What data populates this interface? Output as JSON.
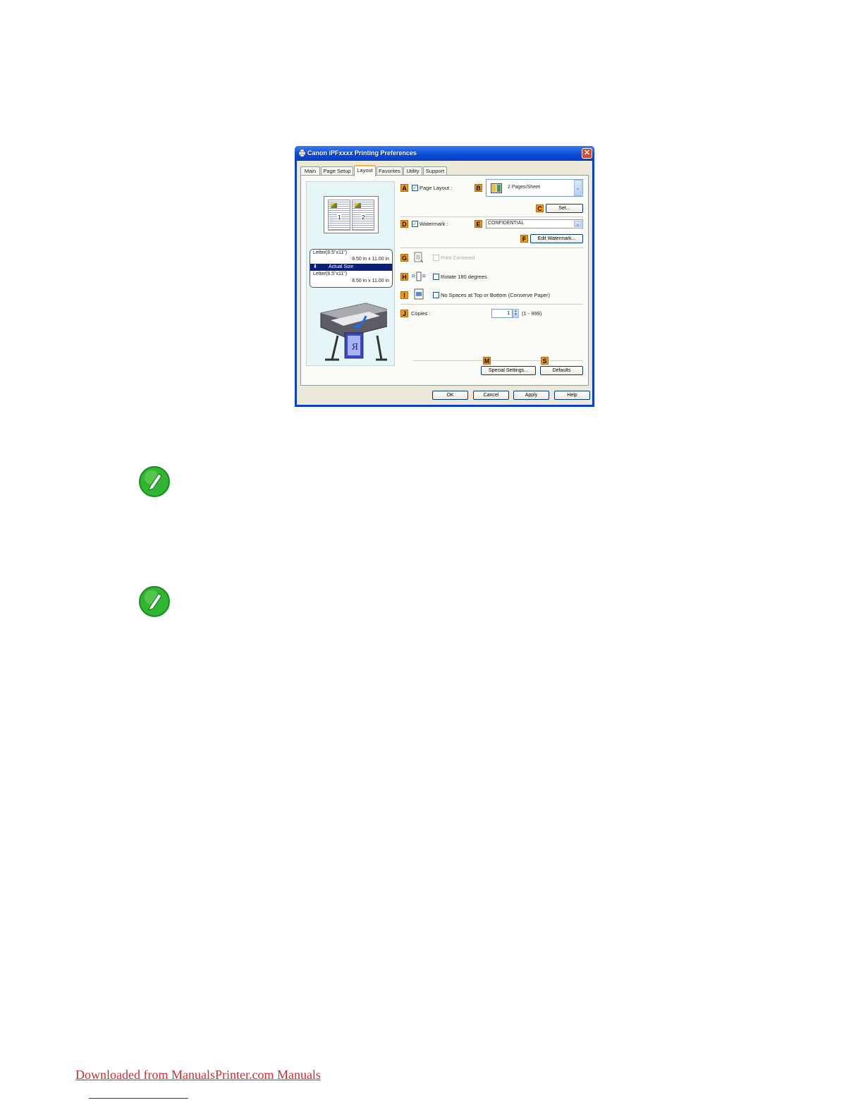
{
  "window": {
    "title": "Canon iPFxxxx Printing Preferences",
    "close_label": "✕"
  },
  "tabs": [
    {
      "label": "Main"
    },
    {
      "label": "Page Setup"
    },
    {
      "label": "Layout",
      "active": true
    },
    {
      "label": "Favorites"
    },
    {
      "label": "Utility"
    },
    {
      "label": "Support"
    }
  ],
  "preview": {
    "page1_num": "1",
    "page2_num": "2",
    "source_size": "Letter(8.5\"x11\")",
    "source_dims": "8.50 in x 11.00 in",
    "scaling": "Actual Size",
    "output_size": "Letter(8.5\"x11\")",
    "output_dims": "8.50 in x 11.00 in",
    "printer_icon": "large-format-printer-illustration"
  },
  "options": {
    "badges": {
      "a": "A",
      "b": "B",
      "c": "C",
      "d": "D",
      "e": "E",
      "f": "F",
      "g": "G",
      "h": "H",
      "i": "I",
      "j": "J",
      "m": "M",
      "s": "S"
    },
    "page_layout": {
      "label": "Page Layout :",
      "checked": true,
      "value": "2 Pages/Sheet"
    },
    "set_button": "Set...",
    "watermark": {
      "label": "Watermark :",
      "checked": true,
      "value": "CONFIDENTIAL"
    },
    "edit_watermark_button": "Edit Watermark...",
    "print_centered": {
      "label": "Print Centered",
      "checked": false,
      "enabled": false
    },
    "rotate": {
      "label": "Rotate 180 degrees",
      "checked": false
    },
    "no_spaces": {
      "label": "No Spaces at Top or Bottom (Conserve Paper)",
      "checked": false
    },
    "copies": {
      "label": "Copies :",
      "value": "1",
      "range": "(1 - 999)"
    },
    "special_settings_button": "Special Settings...",
    "defaults_button": "Defaults"
  },
  "dialog_buttons": {
    "ok": "OK",
    "cancel": "Cancel",
    "apply": "Apply",
    "help": "Help"
  },
  "colors": {
    "badge": "#f39a1a",
    "titlebar": "#0b48d8",
    "footer_link": "#d42a2a"
  },
  "footer": {
    "link_text": "Downloaded from ManualsPrinter.com Manuals"
  }
}
